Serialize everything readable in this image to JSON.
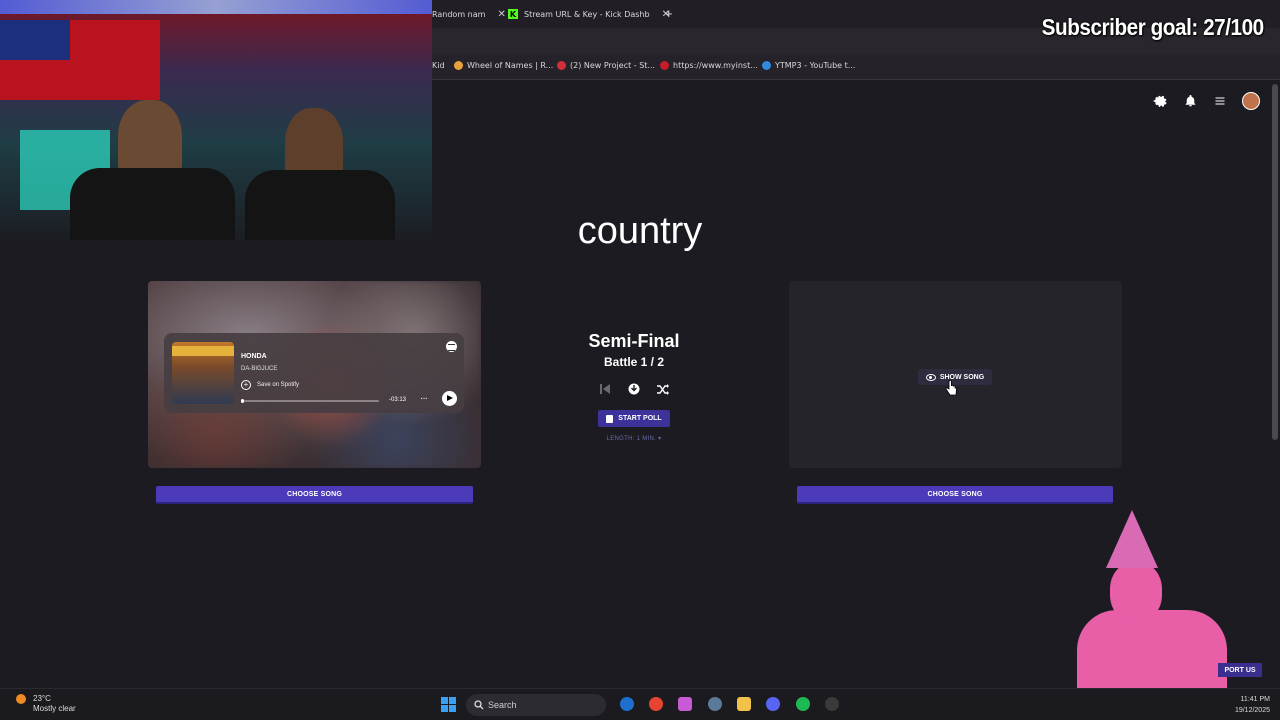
{
  "browser": {
    "tabs": [
      {
        "label": "Random nam",
        "close": "✕"
      },
      {
        "label": "Stream URL & Key - Kick Dashb",
        "close": "✕"
      }
    ],
    "new_tab": "+",
    "bookmarks": [
      {
        "label": "Kid",
        "color": "#888888"
      },
      {
        "label": "Wheel of Names | R...",
        "color": "#e9a23b"
      },
      {
        "label": "(2) New Project - St...",
        "color": "#d12f3a"
      },
      {
        "label": "https://www.myinst...",
        "color": "#c41e2a"
      },
      {
        "label": "YTMP3 - YouTube t...",
        "color": "#2f8be0"
      }
    ]
  },
  "stream_overlay": {
    "subscriber_goal": "Subscriber goal: 27/100",
    "support_label": "PORT US"
  },
  "page": {
    "genre": "country",
    "round": "Semi-Final",
    "battle": "Battle 1 / 2",
    "start_poll": "START POLL",
    "length": "LENGTH: 1 MIN. ▾",
    "left_card": {
      "choose_song": "CHOOSE SONG",
      "player": {
        "title": "HONDA",
        "artist": "DA-BIGJUCE",
        "save": "Save on Spotify",
        "time": "-03:13",
        "more": "···"
      }
    },
    "right_card": {
      "show_song": "SHOW SONG",
      "choose_song": "CHOOSE SONG"
    }
  },
  "taskbar": {
    "temperature": "23°C",
    "weather": "Mostly clear",
    "search_placeholder": "Search",
    "time": "11:41 PM",
    "date": "19/12/2025"
  },
  "colors": {
    "accent_button": "#4b3bb8",
    "background": "#1c1b21",
    "card_empty": "#25242b"
  }
}
